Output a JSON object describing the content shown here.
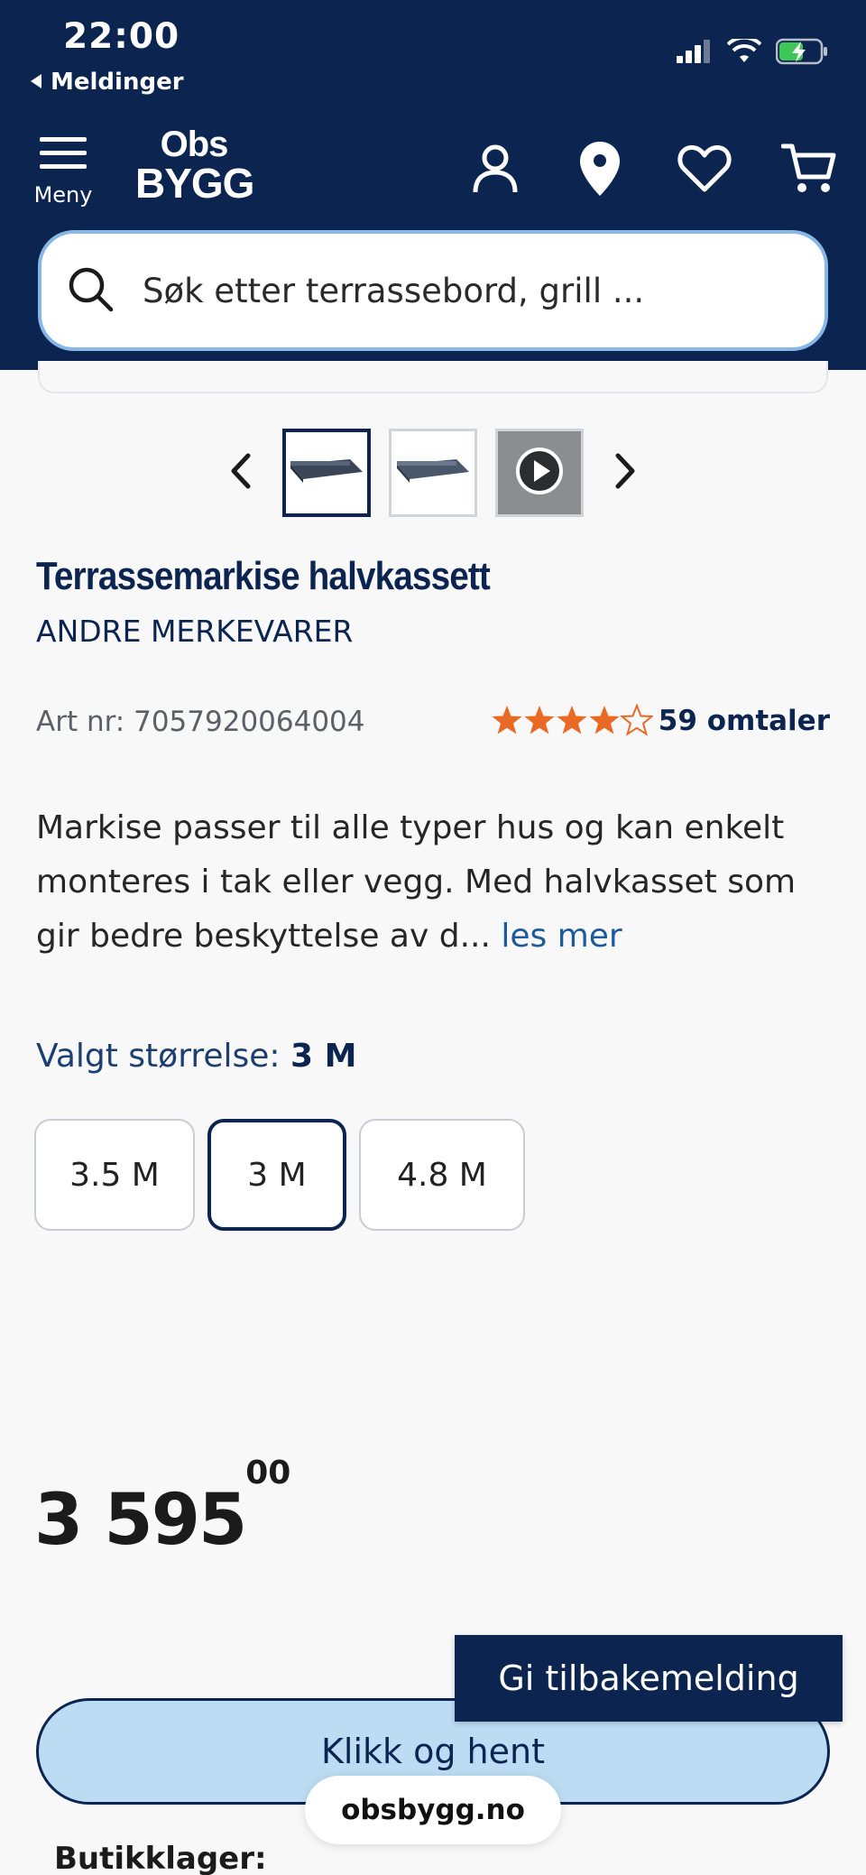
{
  "status_bar": {
    "time": "22:00",
    "back_label": "Meldinger"
  },
  "header": {
    "menu_label": "Meny",
    "logo_top": "Obs",
    "logo_bottom": "BYGG",
    "search_placeholder": "Søk etter terrassebord, grill ..."
  },
  "product": {
    "title": "Terrassemarkise halvkassett",
    "brand": "ANDRE MERKEVARER",
    "art_nr": "Art nr: 7057920064004",
    "rating": 4.5,
    "reviews": "59 omtaler",
    "description": "Markise passer til alle typer hus og kan enkelt monteres i tak eller vegg. Med halvkasset som gir bedre beskyttelse av d...",
    "read_more": "les mer",
    "size_label": "Valgt størrelse:",
    "size_value": "3 M",
    "sizes": [
      "3.5 M",
      "3 M",
      "4.8 M"
    ],
    "price_main": "3 595",
    "price_decimal": "00"
  },
  "actions": {
    "click_collect": "Klikk og hent",
    "feedback": "Gi tilbakemelding",
    "url": "obsbygg.no",
    "stores_label": "Butikklager:"
  },
  "colors": {
    "brand_navy": "#0b2550",
    "star_orange": "#e86a24",
    "cta_light_blue": "#bcdcf4"
  }
}
